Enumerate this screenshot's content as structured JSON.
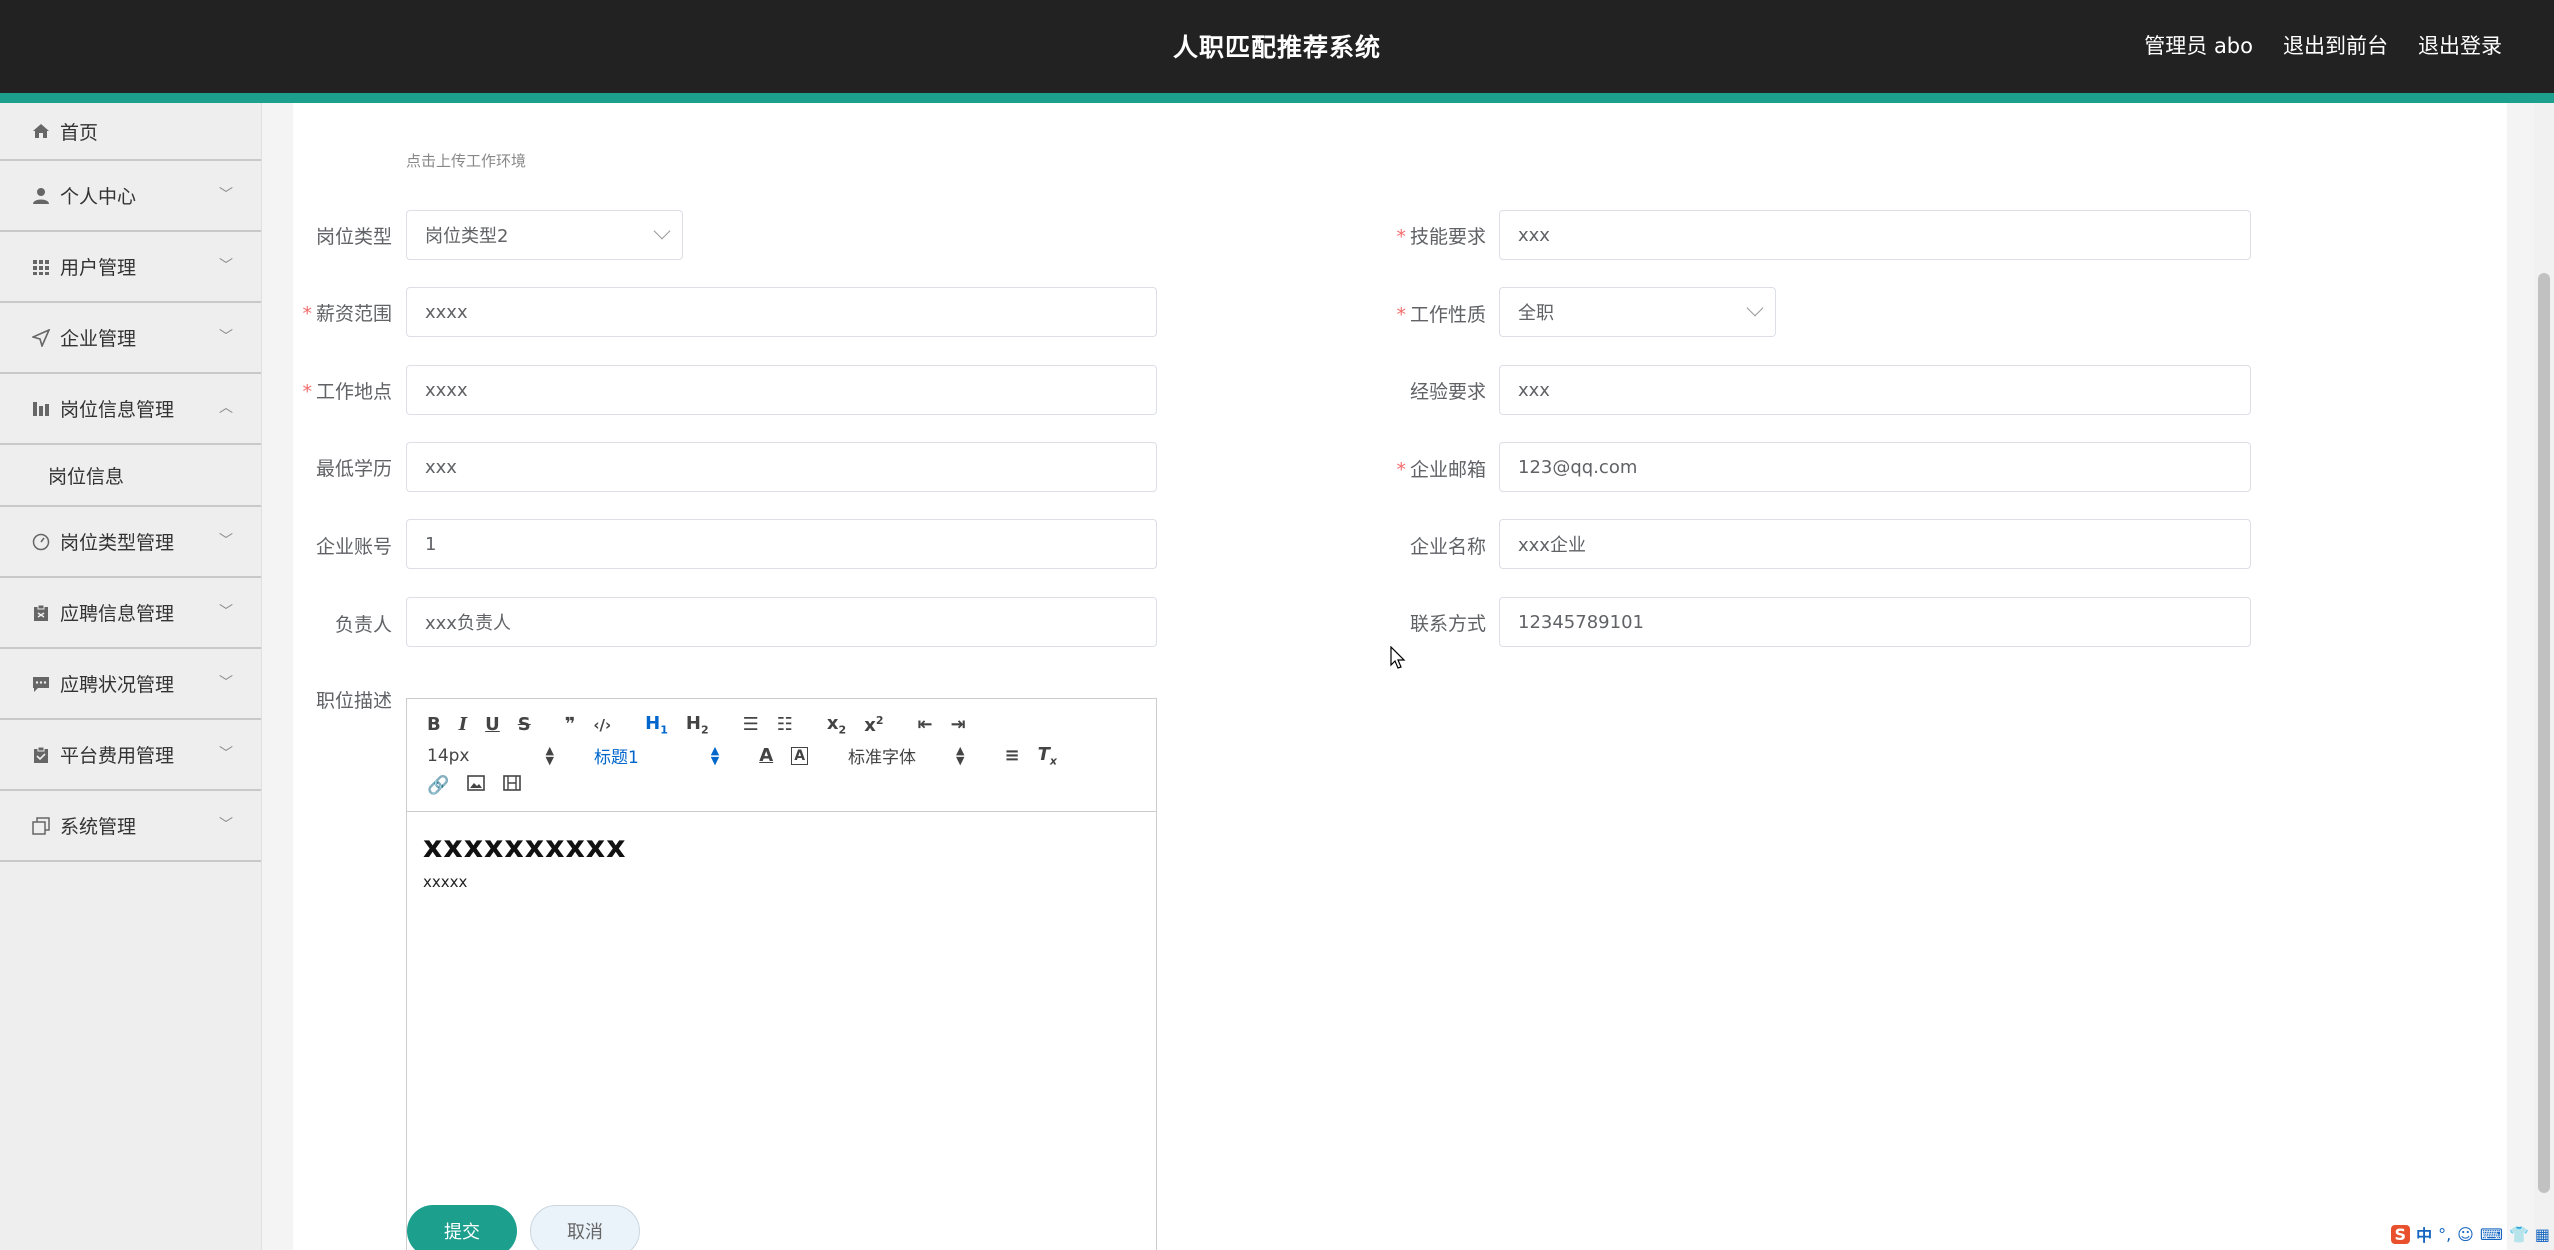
{
  "header": {
    "title": "人职匹配推荐系统",
    "user": "管理员 abo",
    "to_front": "退出到前台",
    "logout": "退出登录"
  },
  "sidebar": {
    "items": [
      {
        "label": "首页",
        "icon": "home-icon"
      },
      {
        "label": "个人中心",
        "icon": "user-icon"
      },
      {
        "label": "用户管理",
        "icon": "grid-icon"
      },
      {
        "label": "企业管理",
        "icon": "send-icon"
      },
      {
        "label": "岗位信息管理",
        "icon": "chart-icon",
        "expanded": true,
        "sub": "岗位信息"
      },
      {
        "label": "岗位类型管理",
        "icon": "gauge-icon"
      },
      {
        "label": "应聘信息管理",
        "icon": "clipboard-icon"
      },
      {
        "label": "应聘状况管理",
        "icon": "chat-icon"
      },
      {
        "label": "平台费用管理",
        "icon": "clipboard-check-icon"
      },
      {
        "label": "系统管理",
        "icon": "copy-icon"
      }
    ]
  },
  "form": {
    "upload_hint": "点击上传工作环境",
    "job_type": {
      "label": "岗位类型",
      "value": "岗位类型2"
    },
    "skill": {
      "label": "技能要求",
      "value": "xxx"
    },
    "salary": {
      "label": "薪资范围",
      "value": "xxxx"
    },
    "nature": {
      "label": "工作性质",
      "value": "全职"
    },
    "location": {
      "label": "工作地点",
      "value": "xxxx"
    },
    "experience": {
      "label": "经验要求",
      "value": "xxx"
    },
    "education": {
      "label": "最低学历",
      "value": "xxx"
    },
    "email": {
      "label": "企业邮箱",
      "value": "123@qq.com"
    },
    "account": {
      "label": "企业账号",
      "value": "1"
    },
    "company": {
      "label": "企业名称",
      "value": "xxx企业"
    },
    "manager": {
      "label": "负责人",
      "value": "xxx负责人"
    },
    "contact": {
      "label": "联系方式",
      "value": "12345789101"
    },
    "description": {
      "label": "职位描述"
    }
  },
  "editor": {
    "font_size": "14px",
    "heading": "标题1",
    "font_family": "标准字体",
    "content_h1": "xxxxxxxxxx",
    "content_p": "xxxxx"
  },
  "actions": {
    "submit": "提交",
    "cancel": "取消"
  },
  "ime": {
    "lang": "中"
  },
  "colors": {
    "accent": "#1d9f8e",
    "header_bg": "#222222",
    "required": "#f56c6c"
  }
}
